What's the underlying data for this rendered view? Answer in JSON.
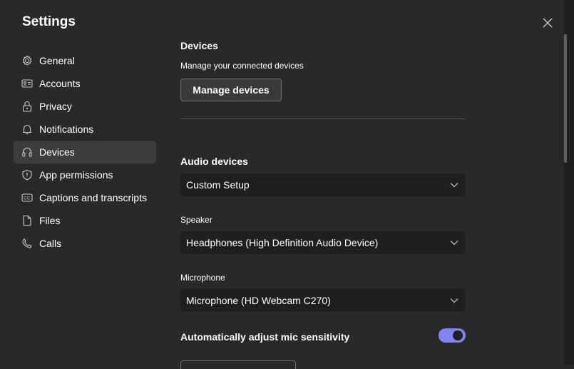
{
  "window": {
    "title": "Settings"
  },
  "sidebar": {
    "items": [
      {
        "label": "General",
        "icon": "gear-icon",
        "active": false
      },
      {
        "label": "Accounts",
        "icon": "id-card-icon",
        "active": false
      },
      {
        "label": "Privacy",
        "icon": "lock-icon",
        "active": false
      },
      {
        "label": "Notifications",
        "icon": "bell-icon",
        "active": false
      },
      {
        "label": "Devices",
        "icon": "headset-icon",
        "active": true
      },
      {
        "label": "App permissions",
        "icon": "shield-icon",
        "active": false
      },
      {
        "label": "Captions and transcripts",
        "icon": "cc-icon",
        "active": false
      },
      {
        "label": "Files",
        "icon": "file-icon",
        "active": false
      },
      {
        "label": "Calls",
        "icon": "phone-icon",
        "active": false
      }
    ]
  },
  "devices": {
    "heading": "Devices",
    "subtitle": "Manage your connected devices",
    "manage_button": "Manage devices"
  },
  "audio": {
    "heading": "Audio devices",
    "setup_value": "Custom Setup",
    "speaker_label": "Speaker",
    "speaker_value": "Headphones (High Definition Audio Device)",
    "mic_label": "Microphone",
    "mic_value": "Microphone (HD Webcam C270)",
    "auto_adjust_label": "Automatically adjust mic sensitivity",
    "auto_adjust_on": true
  },
  "colors": {
    "background": "#292929",
    "accent": "#7f85f5",
    "active_nav": "#3d3d3d"
  }
}
